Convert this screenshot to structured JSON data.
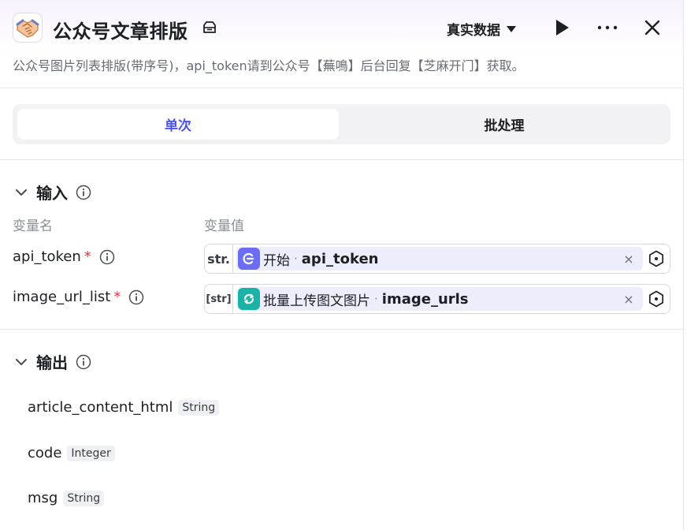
{
  "header": {
    "title": "公众号文章排版",
    "mode_label": "真实数据",
    "icons": [
      "handshake-icon",
      "tag-icon",
      "chevron-down-icon",
      "play-icon",
      "more-icon",
      "close-icon"
    ]
  },
  "description": "公众号图片列表排版(带序号)，api_token请到公众号【蕪鳴】后台回复【芝麻开门】获取。",
  "tabs": [
    {
      "label": "单次",
      "active": true
    },
    {
      "label": "批处理",
      "active": false
    }
  ],
  "input_section": {
    "title": "输入",
    "col_name": "变量名",
    "col_value": "变量值",
    "params": [
      {
        "name": "api_token",
        "required_mark": "*",
        "type": "str.",
        "node": "开始",
        "separator": "·",
        "variable": "api_token",
        "node_color": "#6b6ef5",
        "clear": "×"
      },
      {
        "name": "image_url_list",
        "required_mark": "*",
        "type": "[str]",
        "node": "批量上传图文图片",
        "separator": "·",
        "variable": "image_urls",
        "node_color": "#1bb3a8",
        "clear": "×"
      }
    ]
  },
  "output_section": {
    "title": "输出",
    "items": [
      {
        "name": "article_content_html",
        "type": "String"
      },
      {
        "name": "code",
        "type": "Integer"
      },
      {
        "name": "msg",
        "type": "String"
      }
    ]
  },
  "colors": {
    "accent": "#4c54f0",
    "required": "#e5344a"
  }
}
